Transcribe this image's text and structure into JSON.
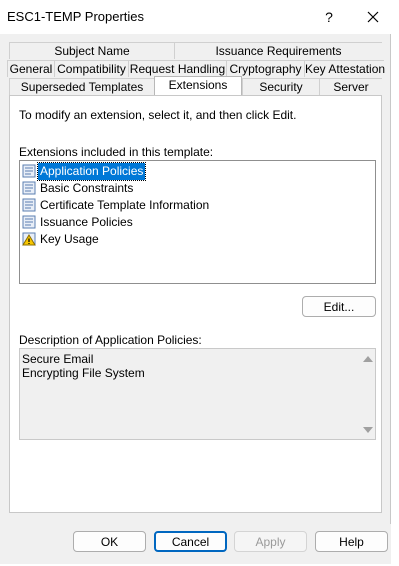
{
  "window": {
    "title": "ESC1-TEMP Properties",
    "help_symbol": "?"
  },
  "tabs": {
    "row1": [
      "Subject Name",
      "Issuance Requirements"
    ],
    "row2": [
      "General",
      "Compatibility",
      "Request Handling",
      "Cryptography",
      "Key Attestation"
    ],
    "row3": [
      "Superseded Templates",
      "Extensions",
      "Security",
      "Server"
    ],
    "active": "Extensions"
  },
  "extensions": {
    "instruction": "To modify an extension, select it, and then click Edit.",
    "list_label": "Extensions included in this template:",
    "items": [
      "Application Policies",
      "Basic Constraints",
      "Certificate Template Information",
      "Issuance Policies",
      "Key Usage"
    ],
    "selected": "Application Policies",
    "edit_label": "Edit...",
    "description_label": "Description of Application Policies:",
    "description_lines": [
      "Secure Email",
      "Encrypting File System"
    ]
  },
  "buttons": {
    "ok": "OK",
    "cancel": "Cancel",
    "apply": "Apply",
    "help": "Help"
  },
  "colors": {
    "selection": "#0078d7",
    "dialog_bg": "#f0f0f0",
    "primary_border": "#0067c0"
  }
}
